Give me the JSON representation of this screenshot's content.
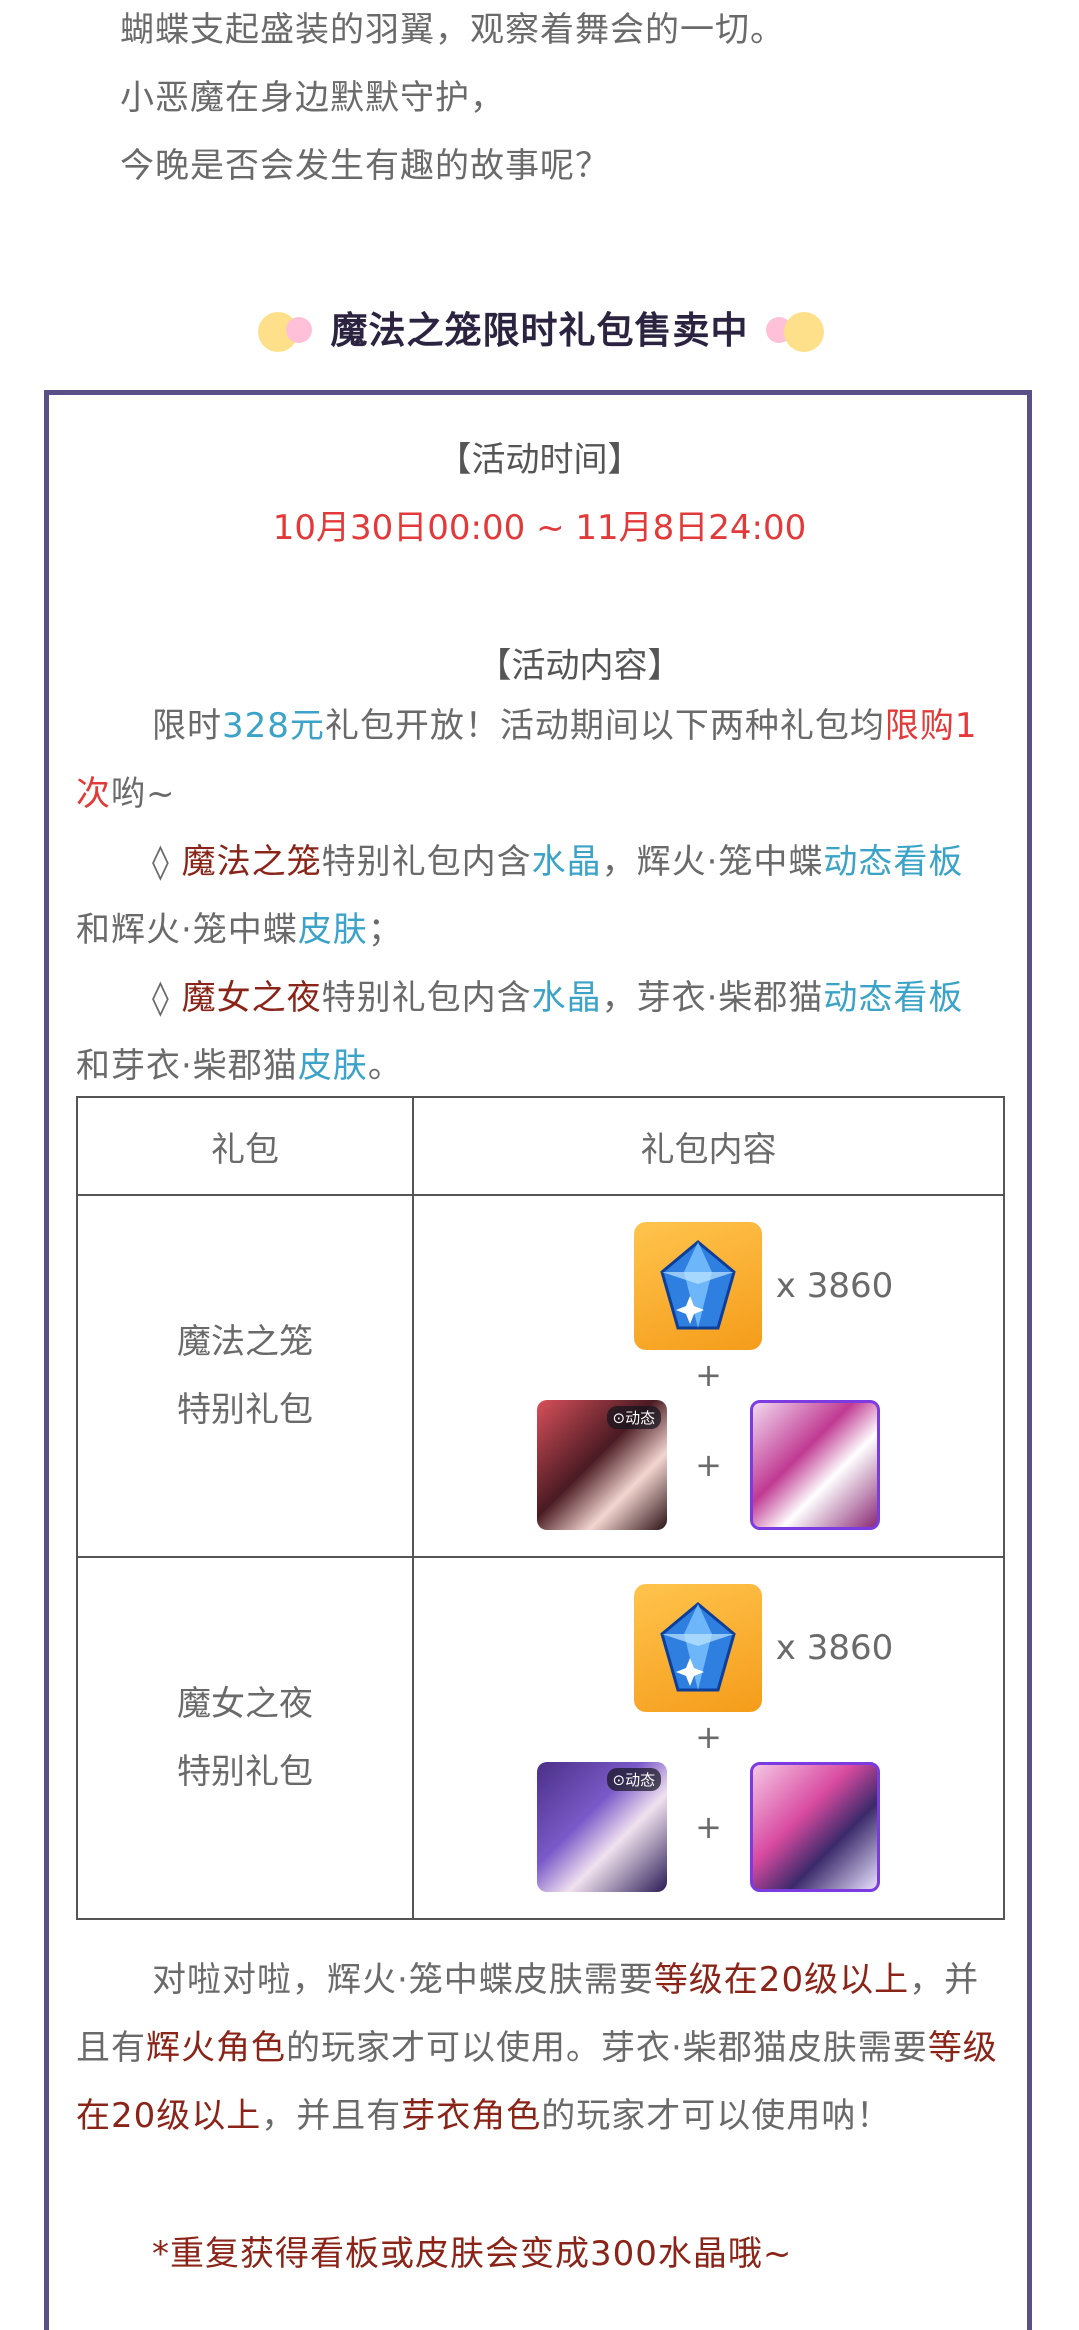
{
  "intro": {
    "line1": "蝴蝶支起盛装的羽翼，观察着舞会的一切。",
    "line2": "小恶魔在身边默默守护，",
    "line3": "今晚是否会发生有趣的故事呢？"
  },
  "section": {
    "title": "魔法之笼限时礼包售卖中"
  },
  "event_time": {
    "heading": "【活动时间】",
    "range": "10月30日00:00 ~ 11月8日24:00"
  },
  "event_content": {
    "heading": "【活动内容】",
    "p1_a": "限时",
    "p1_price": "328元",
    "p1_b": "礼包开放！活动期间以下两种礼包均",
    "p1_limit_1": "限",
    "p1_limit_2": "购1次",
    "p1_c": "哟~",
    "b1_mark": "◊ ",
    "b1_name": "魔法之笼",
    "b1_a": "特别礼包内含",
    "b1_crystal": "水晶",
    "b1_b": "，辉火·笼中蝶",
    "b1_board_1": "动态",
    "b1_board_2": "看板",
    "b1_c": "和辉火·笼中蝶",
    "b1_skin": "皮肤",
    "b1_d": "；",
    "b2_mark": "◊ ",
    "b2_name": "魔女之夜",
    "b2_a": "特别礼包内含",
    "b2_crystal": "水晶",
    "b2_b": "，芽衣·柴郡猫",
    "b2_board_1": "动态",
    "b2_board_2": "看板",
    "b2_c": "和芽衣·柴郡猫",
    "b2_skin": "皮肤",
    "b2_d": "。"
  },
  "table": {
    "col1": "礼包",
    "col2": "礼包内容",
    "rows": [
      {
        "name_1": "魔法之笼",
        "name_2": "特别礼包",
        "qty": "x 3860",
        "plus": "+",
        "badge": "⊙动态"
      },
      {
        "name_1": "魔女之夜",
        "name_2": "特别礼包",
        "qty": "x 3860",
        "plus": "+",
        "badge": "⊙动态"
      }
    ]
  },
  "notes": {
    "a1": "对啦对啦，辉火·笼中蝶皮肤需要",
    "a1_req_1": "等级在20级以",
    "a1_req_2": "上",
    "a1_b": "，并且有",
    "a1_role": "辉火角色",
    "a1_c": "的玩家才可以使用。芽衣·柴郡猫",
    "a2_a": "皮肤需要",
    "a2_req": "等级在20级以上",
    "a2_b": "，并且有",
    "a2_role": "芽衣角色",
    "a2_c": "的玩家才",
    "a2_d": "可以使用呐！",
    "footnote": "*重复获得看板或皮肤会变成300水晶哦~"
  },
  "colors": {
    "accent_red": "#e23a3a",
    "accent_blue": "#3aa3c7",
    "accent_brown": "#8b2418",
    "frame_purple": "#5a4f86"
  }
}
